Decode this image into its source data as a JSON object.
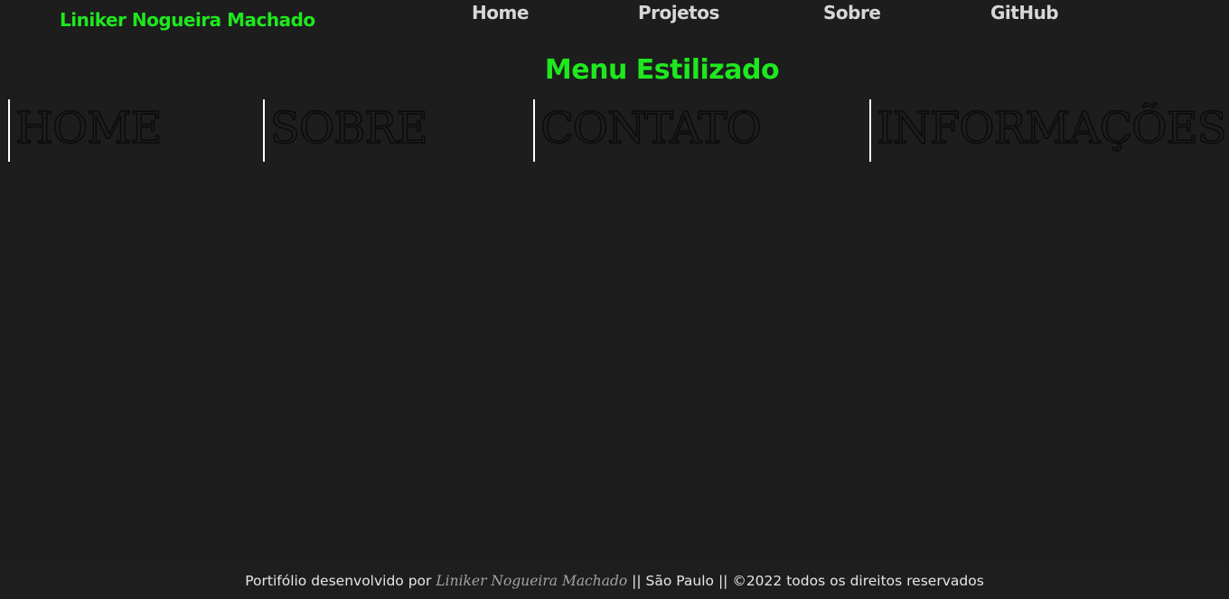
{
  "header": {
    "brand": "Liniker Nogueira Machado",
    "nav": [
      {
        "label": "Home"
      },
      {
        "label": "Projetos"
      },
      {
        "label": "Sobre"
      },
      {
        "label": "GitHub"
      }
    ]
  },
  "main": {
    "title": "Menu Estilizado",
    "styled_menu": [
      {
        "label": "HOME"
      },
      {
        "label": "SOBRE"
      },
      {
        "label": "CONTATO"
      },
      {
        "label": "INFORMAÇÕES"
      }
    ]
  },
  "footer": {
    "prefix": "Portifólio desenvolvido por ",
    "author": "Liniker Nogueira Machado",
    "suffix": " || São Paulo || ©2022 todos os direitos reservados"
  },
  "colors": {
    "background": "#1d1d1d",
    "accent": "#1ee81e",
    "nav_text": "#d7d7d7",
    "menu_divider": "#ffffff"
  }
}
